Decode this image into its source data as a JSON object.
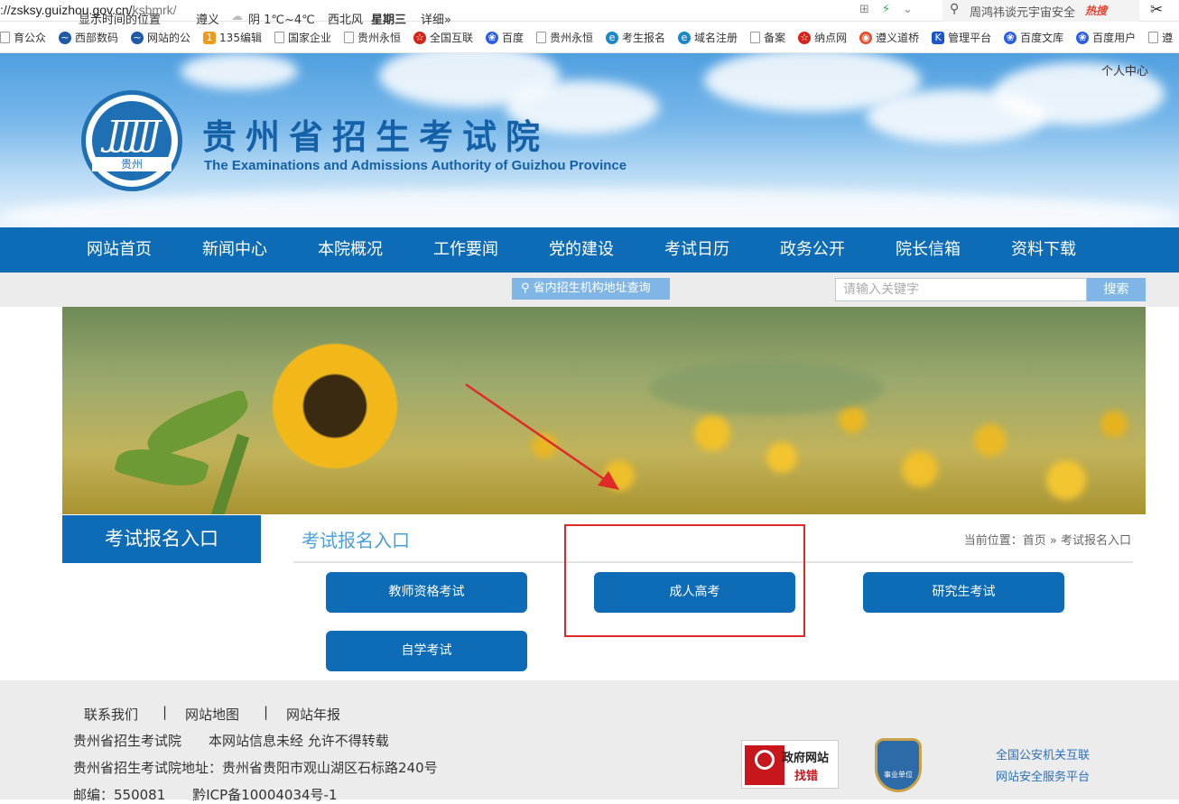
{
  "browser": {
    "url_host": "://zsksy.guizhou.gov.cn/",
    "url_path": "ksbmrk/",
    "search_text": "周鸿祎谈元宇宙安全",
    "search_hot": "热搜",
    "bookmarks": [
      "育公众",
      "西部数码",
      "网站的公",
      "135编辑",
      "国家企业",
      "贵州永恒",
      "全国互联",
      "百度",
      "贵州永恒",
      "考生报名",
      "域名注册",
      "备案",
      "纳点网",
      "遵义道桥",
      "管理平台",
      "百度文库",
      "百度用户",
      "遵"
    ]
  },
  "header": {
    "personal_center": "个人中心",
    "logo_text": "贵州",
    "title": "贵州省招生考试院",
    "subtitle": "The Examinations and Admissions Authority of Guizhou Province"
  },
  "nav": [
    "网站首页",
    "新闻中心",
    "本院概况",
    "工作要闻",
    "党的建设",
    "考试日历",
    "政务公开",
    "院长信箱",
    "资料下载"
  ],
  "infobar": {
    "location_label": "显示时间的位置",
    "city": "遵义",
    "weather": "阴 1℃~4℃",
    "wind": "西北风",
    "weekday": "星期三",
    "detail": "详细»",
    "query_button": "省内招生机构地址查询",
    "search_placeholder": "请输入关键字",
    "search_button": "搜索"
  },
  "main": {
    "side_title": "考试报名入口",
    "content_title": "考试报名入口",
    "breadcrumb": "当前位置：首页 » 考试报名入口",
    "exams": [
      "教师资格考试",
      "成人高考",
      "研究生考试",
      "自学考试"
    ]
  },
  "footer": {
    "links": [
      "联系我们",
      "网站地图",
      "网站年报"
    ],
    "separator": "|",
    "line1": "贵州省招生考试院　　本网站信息未经 允许不得转载",
    "line2": "贵州省招生考试院地址：贵州省贵阳市观山湖区石标路240号",
    "line3": "邮编：550081　　黔ICP备10004034号-1",
    "gov_badge_1": "政府网站",
    "gov_badge_2": "找错",
    "shield_text": "事业单位",
    "police_1": "全国公安机关互联",
    "police_2": "网站安全服务平台"
  },
  "colors": {
    "primary_blue": "#0d6cb5",
    "light_blue": "#7fb6e6",
    "annotation_red": "#e02a2a"
  }
}
